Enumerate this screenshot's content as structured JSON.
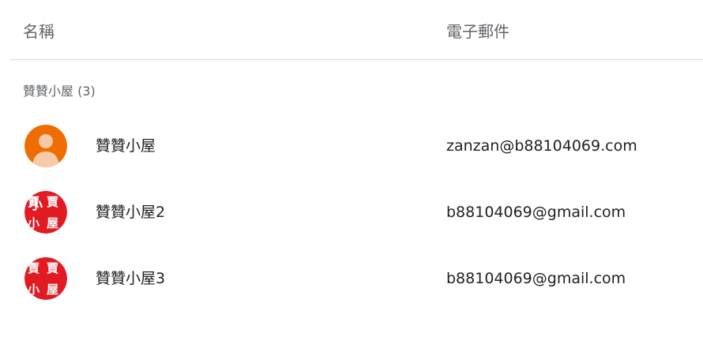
{
  "header": {
    "name_label": "名稱",
    "email_label": "電子郵件"
  },
  "group": {
    "label": "贊贊小屋 (3)"
  },
  "contacts": [
    {
      "name": "贊贊小屋",
      "email": "zanzan@b88104069.com",
      "avatar_icon": "default-person-icon",
      "avatar_color": "#ef6c00"
    },
    {
      "name": "贊贊小屋2",
      "email": "b88104069@gmail.com",
      "avatar_icon": "calligraphy-avatar-icon",
      "avatar_color": "#e21b23",
      "avatar_text": "贊贊小屋"
    },
    {
      "name": "贊贊小屋3",
      "email": "b88104069@gmail.com",
      "avatar_icon": "calligraphy-avatar-icon",
      "avatar_color": "#e21b23",
      "avatar_text": "贊贊小屋"
    }
  ],
  "colors": {
    "header_text": "#5f6368",
    "body_text": "#202124",
    "divider": "#dadce0"
  }
}
